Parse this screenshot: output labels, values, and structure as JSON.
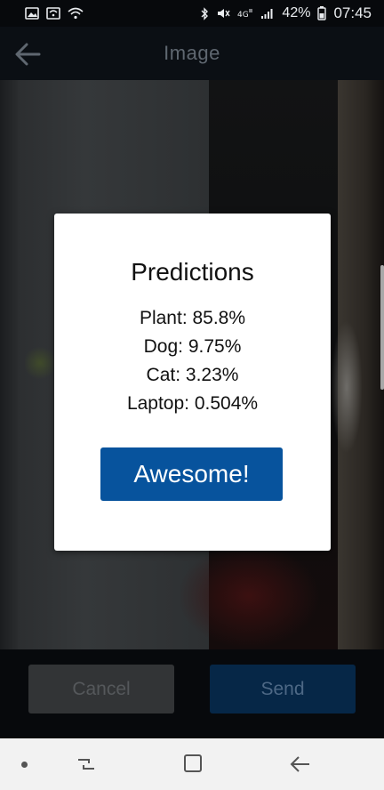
{
  "status_bar": {
    "battery_percent": "42%",
    "time": "07:45",
    "icons": [
      "gallery-icon",
      "wifi-calling-icon",
      "wifi-icon",
      "bluetooth-icon",
      "mute-icon",
      "4g-icon",
      "signal-icon",
      "battery-icon"
    ]
  },
  "app_bar": {
    "title": "Image",
    "back_icon": "arrow-left-icon"
  },
  "dialog": {
    "title": "Predictions",
    "predictions": [
      {
        "text": "Plant: 85.8%"
      },
      {
        "text": "Dog: 9.75%"
      },
      {
        "text": "Cat: 3.23%"
      },
      {
        "text": "Laptop: 0.504%"
      }
    ],
    "button_label": "Awesome!"
  },
  "actions": {
    "cancel_label": "Cancel",
    "send_label": "Send"
  },
  "nav_bar": {
    "icons": [
      "dot-icon",
      "recents-icon",
      "home-icon",
      "back-icon"
    ]
  },
  "colors": {
    "dialog_button": "#07539d",
    "send_button": "#062747",
    "cancel_button": "#323436",
    "app_bar_bg": "#0b0f14"
  }
}
